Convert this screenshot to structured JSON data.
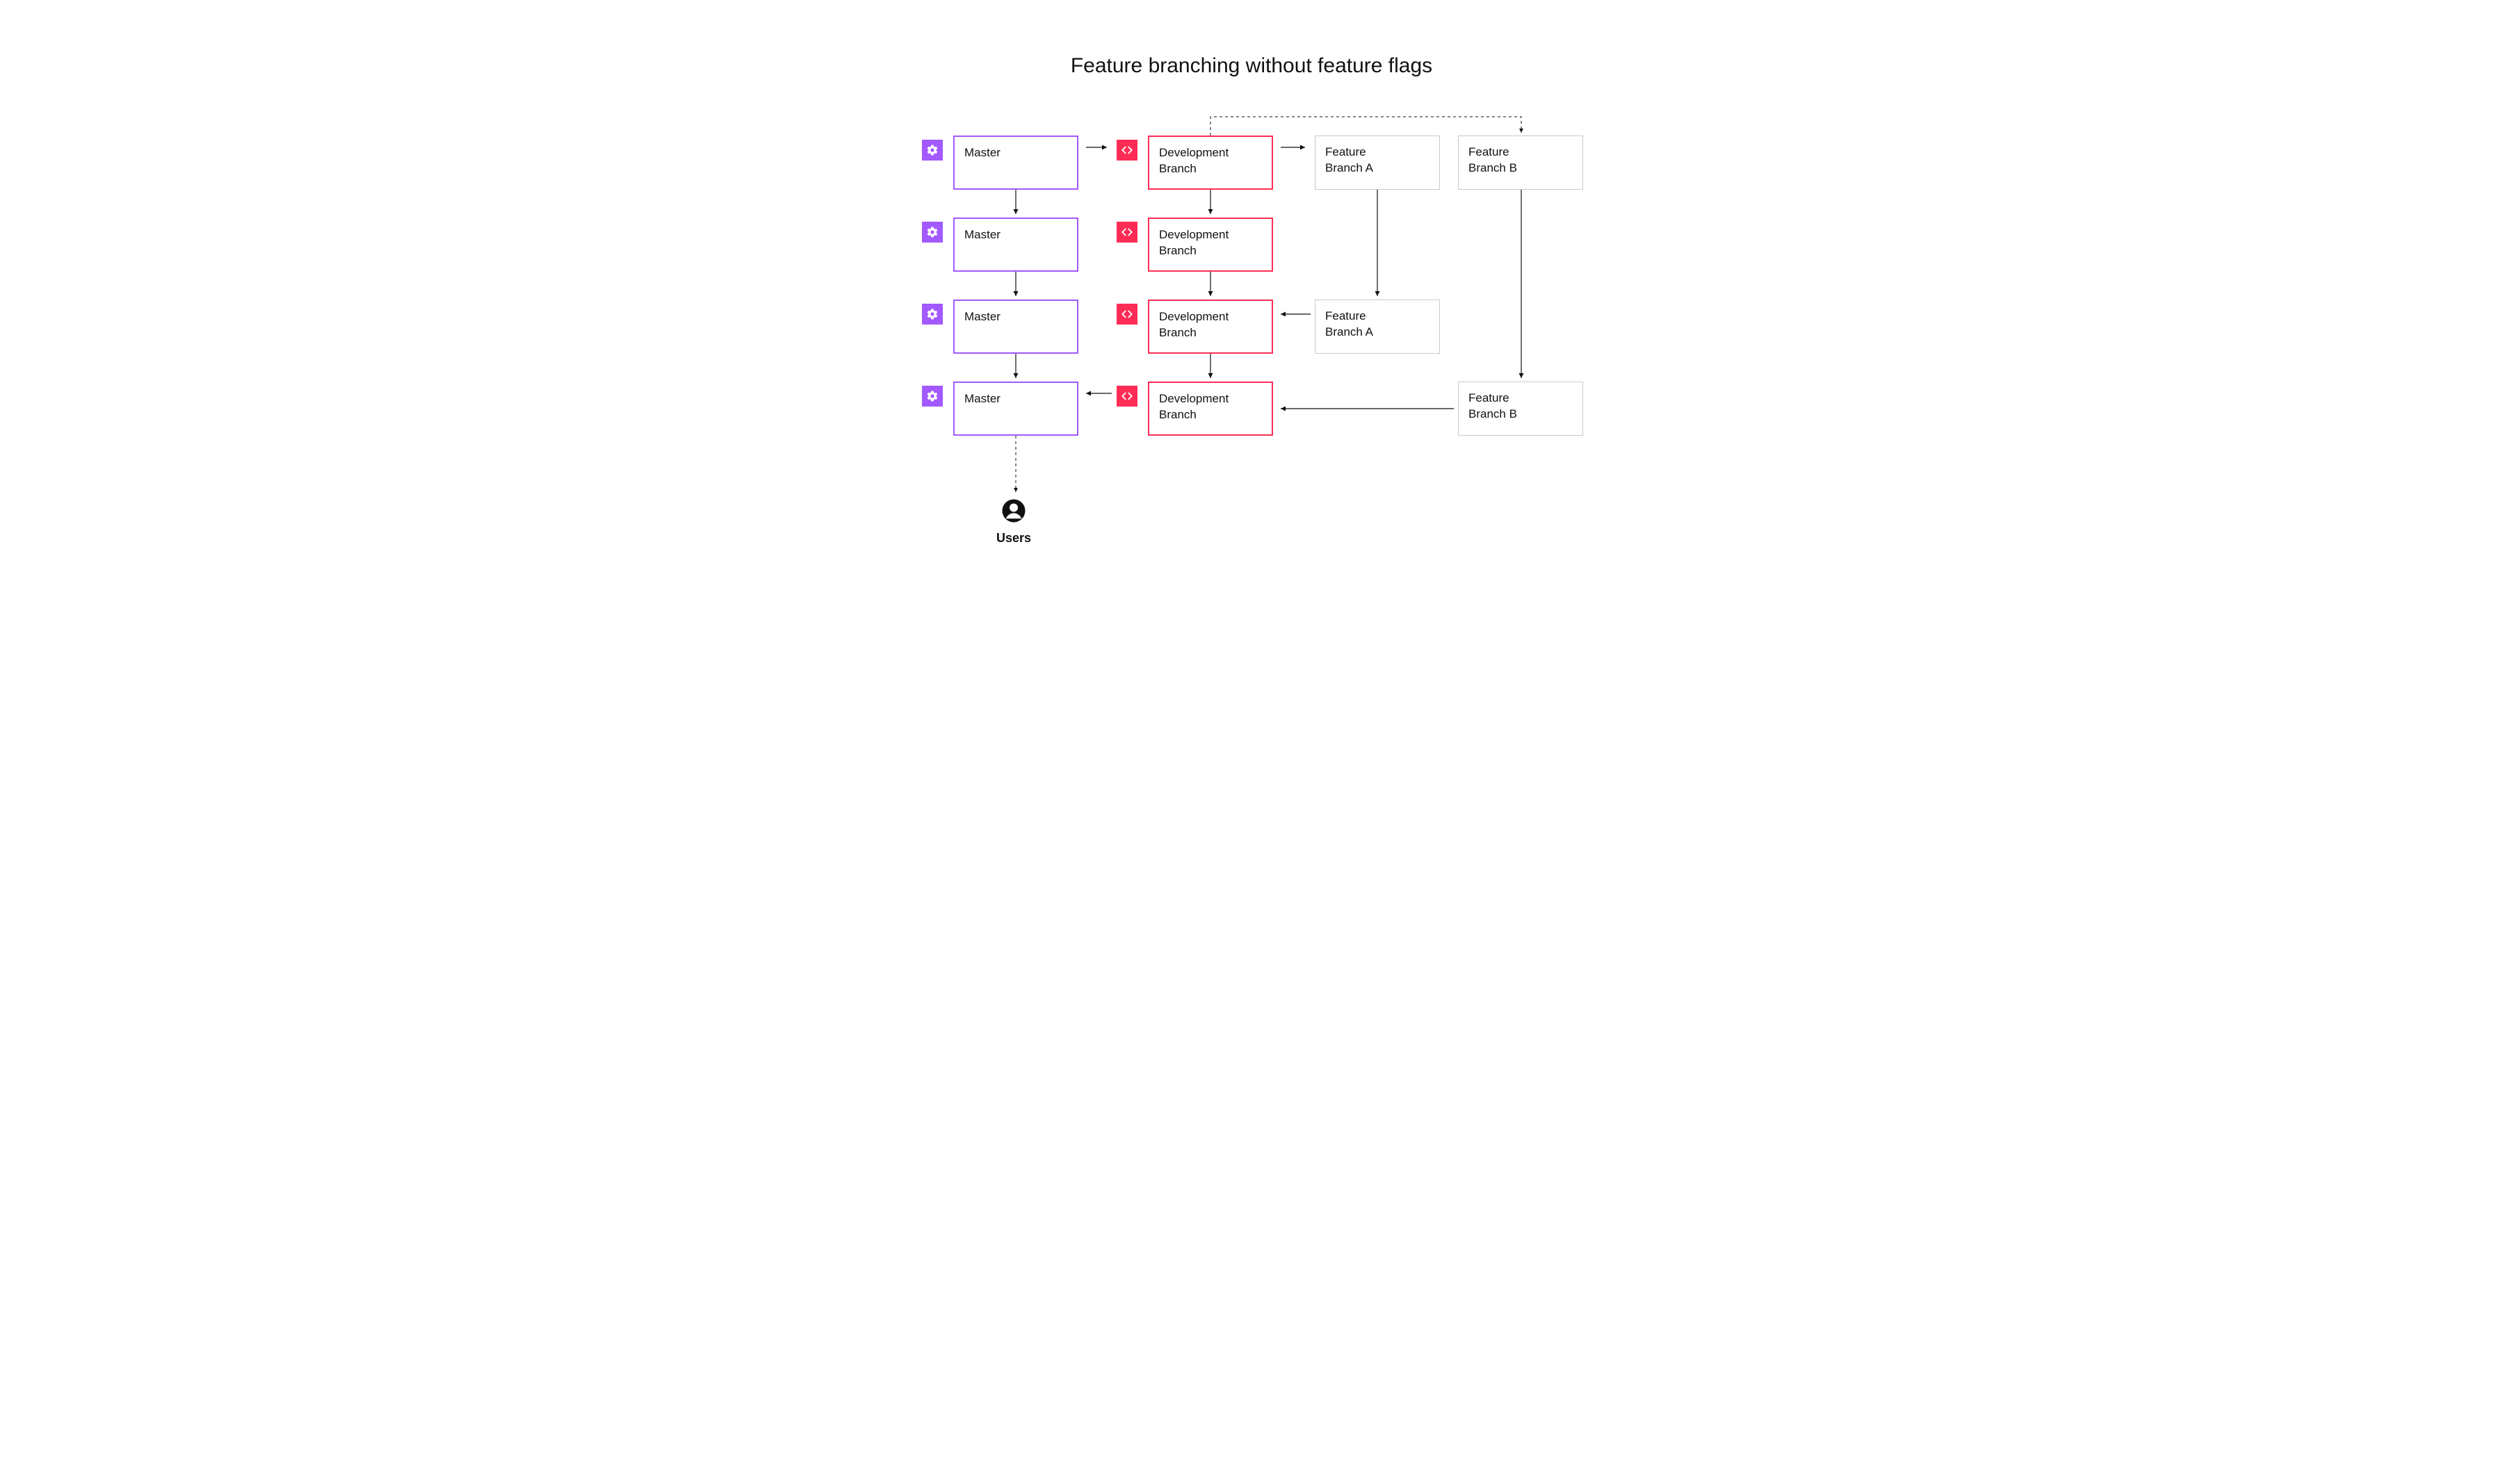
{
  "title": "Feature branching without feature flags",
  "colors": {
    "purple": "#a259ff",
    "pink": "#ff2d55",
    "gray_border": "#c9c9c9",
    "text": "#111111",
    "arrow": "#111111"
  },
  "master": {
    "row1": "Master",
    "row2": "Master",
    "row3": "Master",
    "row4": "Master"
  },
  "dev": {
    "row1": "Development\nBranch",
    "row2": "Development\nBranch",
    "row3": "Development\nBranch",
    "row4": "Development\nBranch"
  },
  "featureA": {
    "row1": "Feature\nBranch A",
    "row3": "Feature\nBranch A"
  },
  "featureB": {
    "row1": "Feature\nBranch B",
    "row4": "Feature\nBranch B"
  },
  "users_label": "Users",
  "icons": {
    "gear": "gear-icon",
    "code": "code-icon",
    "user": "user-icon"
  }
}
